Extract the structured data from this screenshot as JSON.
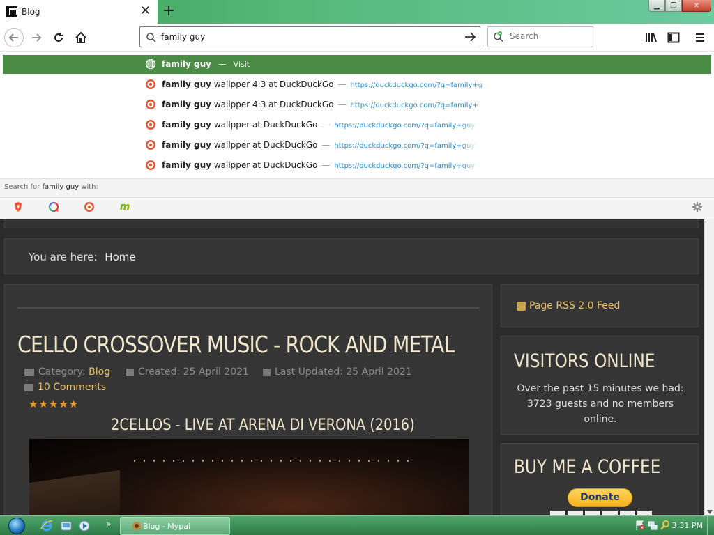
{
  "browser": {
    "tab_title": "Blog",
    "url_value": "family guy",
    "search_placeholder": "Search"
  },
  "autocomplete": {
    "visit_row": {
      "term": "family guy",
      "suffix": " — ",
      "action": "Visit"
    },
    "rows": [
      {
        "term": "family guy",
        "rest": " wallpper 4:3 at DuckDuckGo",
        "url": "https://duckduckgo.com/?q=family+g"
      },
      {
        "term": "family guy",
        "rest": " wallpper 4:3 at DuckDuckGo",
        "url": "https://duckduckgo.com/?q=family+"
      },
      {
        "term": "family guy",
        "rest": " wallpper at DuckDuckGo",
        "url": "https://duckduckgo.com/?q=family+guy"
      },
      {
        "term": "family guy",
        "rest": " wallpper at DuckDuckGo",
        "url": "https://duckduckgo.com/?q=family+guy"
      },
      {
        "term": "family guy",
        "rest": " wallpper at DuckDuckGo",
        "url": "https://duckduckgo.com/?q=family+guy"
      }
    ],
    "separator": "—",
    "search_with": {
      "prefix": "Search for ",
      "term": "family guy",
      "suffix": " with:"
    },
    "engine_icons": [
      "brave-icon",
      "qwant-icon",
      "duckduckgo-icon",
      "mojeek-icon"
    ]
  },
  "page": {
    "breadcrumb_label": "You are here:",
    "breadcrumb_home": "Home",
    "article_title": "CELLO CROSSOVER MUSIC - ROCK AND METAL",
    "category_label": "Category:",
    "category_value": "Blog",
    "created": "Created: 25 April 2021",
    "updated": "Last Updated: 25 April 2021",
    "comments": "10 Comments",
    "stars": "★★★★★",
    "video_title": "2CELLOS - LIVE AT ARENA DI VERONA (2016)",
    "rss_link": "Page RSS 2.0 Feed",
    "visitors_title": "VISITORS ONLINE",
    "visitors_text": "Over the past 15 minutes we had: 3723 guests and no members online.",
    "coffee_title": "BUY ME A COFFEE",
    "donate_label": "Donate"
  },
  "taskbar": {
    "active_task": "Blog - Mypal",
    "overflow": "»",
    "clock": "3:31 PM"
  },
  "colors": {
    "selection_green": "#4a8c45",
    "accent_gold": "#e8c26a",
    "star_orange": "#f09b21"
  }
}
